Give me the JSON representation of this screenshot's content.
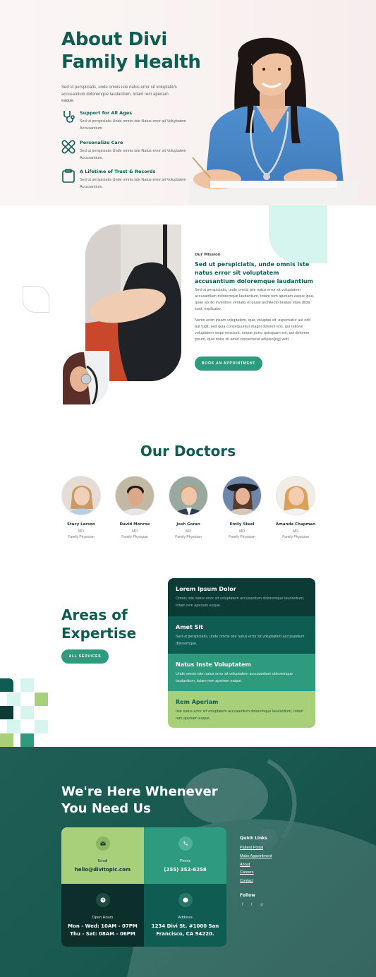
{
  "hero": {
    "title": "About Divi Family Health",
    "description": "Sed ut perspiciatis, unde omnis iste natus error sit voluptatem accusantium doloremque laudantium, totam rem aperiam eaque.",
    "features": [
      {
        "icon": "stethoscope-icon",
        "title": "Support for All Ages",
        "text": "Sed ut perspiciatis Unde omnis iste Natus error sit Voluptatem Accusantium."
      },
      {
        "icon": "bandage-icon",
        "title": "Personalize Care",
        "text": "Sed ut perspiciatis Unde omnis iste Natus error sit Voluptatem Accusantium."
      },
      {
        "icon": "clipboard-icon",
        "title": "A Lifetime of Trust & Records",
        "text": "Sed ut perspiciatis Unde omnis iste Natus error sit Voluptatem Accusantium."
      }
    ]
  },
  "mission": {
    "label": "Our Mission",
    "heading": "Sed ut perspiciatis, unde omnis iste natus error sit voluptatem accusantium doloremque laudantium",
    "para1": "Sed ut perspiciatis, unde omnis iste natus error sit voluptatem accusantium doloremque laudantium, totam rem aperiam eaque ipsa, quae ab illo inventore veritatis et quasi architecto beatae vitae dicta sunt, explicabo.",
    "para2": "Nemo enim ipsam voluptatem, quia voluptas sit, aspernatur aut odit aut fugit, sed quia consequuntur magni dolores eos, qui ratione voluptatem sequi nesciunt, neque porro quisquam est, qui dolorem ipsum, quia dolor sit amet consectetur adipisci[ng] velit,",
    "button": "BOOK AN APPOINTMENT"
  },
  "doctors": {
    "title": "Our Doctors",
    "items": [
      {
        "name": "Stacy Larson",
        "degree": "MD",
        "role": "Family Physician"
      },
      {
        "name": "David Monroe",
        "degree": "MD",
        "role": "Family Physician"
      },
      {
        "name": "Josh Goran",
        "degree": "MD",
        "role": "Family Physician"
      },
      {
        "name": "Emily Steel",
        "degree": "MD",
        "role": "Family Physician"
      },
      {
        "name": "Amanda Chapman",
        "degree": "MD",
        "role": "Family Physician"
      }
    ]
  },
  "expertise": {
    "title": "Areas of Expertise",
    "button": "ALL SERVICES",
    "cards": [
      {
        "title": "Lorem Ipsum Dolor",
        "text": "Omnis iste natus error sit voluptatem accusantium doloremque laudantium, totam rem aperiam eaque.",
        "bg": "#0c3a35"
      },
      {
        "title": "Amet Sit",
        "text": "Sed ut perspiciatis, unde omnis iste natus error sit voluptatem accusantium doloremque.",
        "bg": "#0e5c52"
      },
      {
        "title": "Natus Inste Voluptatem",
        "text": "Unde omnis iste natus error sit voluptatem accusantium doloremque laudantium, totam rem aperiam eaque.",
        "bg": "#2e9b7e"
      },
      {
        "title": "Rem Aperiam",
        "text": "Iste natus error sit voluptatem accusantium doloremque laudantium, totam rem aperiam eaque.",
        "bg": "#a8d07a"
      }
    ]
  },
  "contact": {
    "title": "We're Here Whenever You Need Us",
    "email_label": "Email",
    "email": "hello@divitopic.com",
    "phone_label": "Phone",
    "phone": "(255) 352-6258",
    "hours_label": "Open Hours",
    "hours_1": "Mon - Wed: 10AM - 07PM",
    "hours_2": "Thu - Sat: 08AM - 06PM",
    "address_label": "Address",
    "address_1": "1234 Divi St. #1000 San",
    "address_2": "Francisco, CA 94220.",
    "quick_links_title": "Quick Links",
    "links": [
      "Patient Portal",
      "Make Appointment",
      "About",
      "Careers",
      "Contact"
    ],
    "follow_title": "Follow",
    "social": [
      "f",
      "t",
      "yt"
    ]
  },
  "colors": {
    "brand": "#0e5c52",
    "accent": "#2e9b7e",
    "lime": "#a8d07a",
    "mint": "#d7f5ef"
  }
}
